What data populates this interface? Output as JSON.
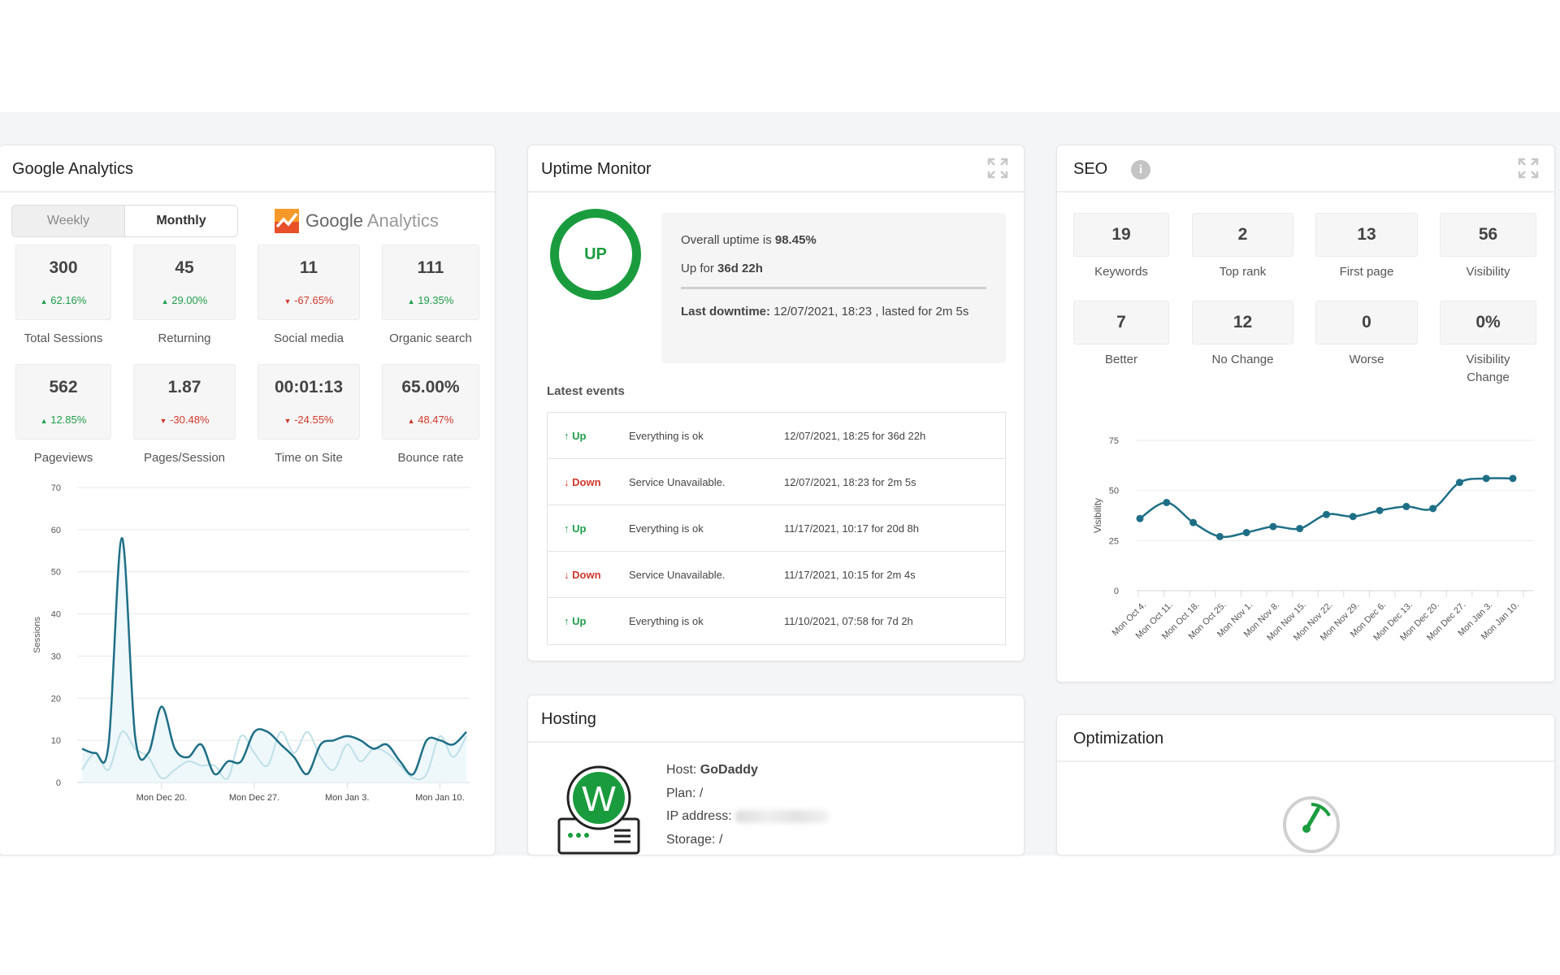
{
  "google_analytics": {
    "title": "Google Analytics",
    "toggle": {
      "weekly": "Weekly",
      "monthly": "Monthly",
      "selected": "Monthly"
    },
    "logo": {
      "google": "Google",
      "analytics": "Analytics"
    },
    "stats": [
      {
        "value": "300",
        "change": "62.16%",
        "arrow": "▲",
        "sentiment": "good",
        "label": "Total Sessions"
      },
      {
        "value": "45",
        "change": "29.00%",
        "arrow": "▲",
        "sentiment": "good",
        "label": "Returning"
      },
      {
        "value": "11",
        "change": "-67.65%",
        "arrow": "▼",
        "sentiment": "bad",
        "label": "Social media"
      },
      {
        "value": "111",
        "change": "19.35%",
        "arrow": "▲",
        "sentiment": "good",
        "label": "Organic search"
      },
      {
        "value": "562",
        "change": "12.85%",
        "arrow": "▲",
        "sentiment": "good",
        "label": "Pageviews"
      },
      {
        "value": "1.87",
        "change": "-30.48%",
        "arrow": "▼",
        "sentiment": "bad",
        "label": "Pages/Session"
      },
      {
        "value": "00:01:13",
        "change": "-24.55%",
        "arrow": "▼",
        "sentiment": "bad",
        "label": "Time on Site"
      },
      {
        "value": "65.00%",
        "change": "48.47%",
        "arrow": "▲",
        "sentiment": "bad",
        "label": "Bounce rate"
      }
    ]
  },
  "uptime": {
    "title": "Uptime Monitor",
    "status": "UP",
    "overall_prefix": "Overall uptime is ",
    "overall_value": "98.45%",
    "upfor_prefix": "Up for ",
    "upfor_value": "36d 22h",
    "last_downtime_label": "Last downtime:",
    "last_downtime_value": " 12/07/2021, 18:23 , lasted for 2m 5s",
    "events_title": "Latest events",
    "events": [
      {
        "status": "Up",
        "arrow": "↑",
        "message": "Everything is ok",
        "when": "12/07/2021, 18:25 for 36d 22h"
      },
      {
        "status": "Down",
        "arrow": "↓",
        "message": "Service Unavailable.",
        "when": "12/07/2021, 18:23 for 2m 5s"
      },
      {
        "status": "Up",
        "arrow": "↑",
        "message": "Everything is ok",
        "when": "11/17/2021, 10:17 for 20d 8h"
      },
      {
        "status": "Down",
        "arrow": "↓",
        "message": "Service Unavailable.",
        "when": "11/17/2021, 10:15 for 2m 4s"
      },
      {
        "status": "Up",
        "arrow": "↑",
        "message": "Everything is ok",
        "when": "11/10/2021, 07:58 for 7d 2h"
      }
    ]
  },
  "hosting": {
    "title": "Hosting",
    "host_label": "Host: ",
    "host_value": "GoDaddy",
    "plan_label": "Plan: ",
    "plan_value": "/",
    "ip_label": "IP address: ",
    "storage_label": "Storage: ",
    "storage_value": "/"
  },
  "seo": {
    "title": "SEO",
    "stats": [
      {
        "value": "19",
        "label": "Keywords"
      },
      {
        "value": "2",
        "label": "Top rank"
      },
      {
        "value": "13",
        "label": "First page"
      },
      {
        "value": "56",
        "label": "Visibility"
      },
      {
        "value": "7",
        "label": "Better"
      },
      {
        "value": "12",
        "label": "No Change"
      },
      {
        "value": "0",
        "label": "Worse"
      },
      {
        "value": "0%",
        "label": "Visibility Change"
      }
    ]
  },
  "optimization": {
    "title": "Optimization"
  },
  "colors": {
    "accent": "#1e6f86",
    "light_series": "#bfe0e8",
    "up": "#1e9e4a",
    "down": "#d0382b",
    "ga_orange": "#f0862a"
  },
  "chart_data": [
    {
      "type": "area",
      "ylabel": "Sessions",
      "ylim": [
        0,
        70
      ],
      "yticks": [
        0,
        10,
        20,
        30,
        40,
        50,
        60,
        70
      ],
      "x": [
        "Dec 14",
        "Dec 15",
        "Dec 16",
        "Dec 17",
        "Dec 18",
        "Dec 19",
        "Dec 20",
        "Dec 21",
        "Dec 22",
        "Dec 23",
        "Dec 24",
        "Dec 25",
        "Dec 26",
        "Dec 27",
        "Dec 28",
        "Dec 29",
        "Dec 30",
        "Dec 31",
        "Jan 1",
        "Jan 2",
        "Jan 3",
        "Jan 4",
        "Jan 5",
        "Jan 6",
        "Jan 7",
        "Jan 8",
        "Jan 9",
        "Jan 10",
        "Jan 11",
        "Jan 12"
      ],
      "xtick_labels": [
        {
          "at": "Dec 20",
          "label": "Mon Dec 20."
        },
        {
          "at": "Dec 27",
          "label": "Mon Dec 27."
        },
        {
          "at": "Jan 3",
          "label": "Mon Jan 3."
        },
        {
          "at": "Jan 10",
          "label": "Mon Jan 10."
        }
      ],
      "grid": true,
      "series": [
        {
          "values": [
            8,
            7,
            9,
            58,
            11,
            7,
            18,
            8,
            6,
            9,
            2,
            5,
            5,
            12,
            12,
            9,
            6,
            2,
            9,
            10,
            11,
            10,
            8,
            9,
            5,
            2,
            10,
            10,
            9,
            12
          ],
          "color": "#1e6f86"
        },
        {
          "values": [
            3,
            7,
            3,
            12,
            8,
            6,
            1,
            3,
            5,
            4,
            4,
            1,
            11,
            7,
            4,
            12,
            7,
            12,
            6,
            3,
            9,
            5,
            8,
            7,
            4,
            1,
            2,
            11,
            6,
            11
          ],
          "color": "#bfe0e8"
        }
      ]
    },
    {
      "type": "line",
      "ylabel": "Visibility",
      "ylim": [
        0,
        75
      ],
      "yticks": [
        0,
        25,
        50,
        75
      ],
      "categories": [
        "Mon Oct 4.",
        "Mon Oct 11.",
        "Mon Oct 18.",
        "Mon Oct 25.",
        "Mon Nov 1.",
        "Mon Nov 8.",
        "Mon Nov 15.",
        "Mon Nov 22.",
        "Mon Nov 29.",
        "Mon Dec 6.",
        "Mon Dec 13.",
        "Mon Dec 20.",
        "Mon Dec 27.",
        "Mon Jan 3.",
        "Mon Jan 10."
      ],
      "values": [
        36,
        44,
        34,
        27,
        29,
        32,
        31,
        38,
        37,
        40,
        42,
        41,
        54,
        56,
        56
      ],
      "grid": true,
      "color": "#1e6f86"
    }
  ]
}
